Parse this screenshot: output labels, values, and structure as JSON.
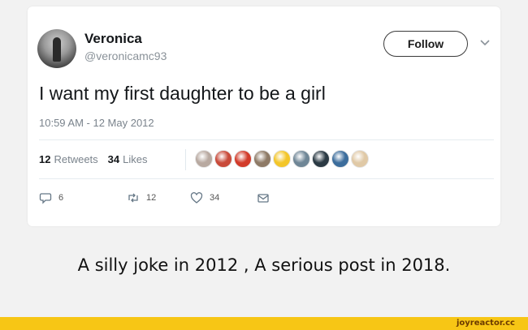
{
  "tweet": {
    "author_name": "Veronica",
    "handle": "@veronicamc93",
    "follow_label": "Follow",
    "text": "I want my first daughter to be a girl",
    "timestamp": "10:59 AM - 12 May 2012",
    "retweets_count": "12",
    "retweets_label": "Retweets",
    "likes_count": "34",
    "likes_label": "Likes",
    "reply_count": "6",
    "retweet_action_count": "12",
    "like_action_count": "34",
    "icons": {
      "reply": "reply-icon",
      "retweet": "retweet-icon",
      "like": "heart-icon",
      "dm": "direct-message-icon",
      "menu": "chevron-down-icon"
    },
    "liker_colors": [
      "#b8a9a0",
      "#c94a3a",
      "#d23b2a",
      "#8e7a66",
      "#f3c62a",
      "#6f8696",
      "#2b3a44",
      "#3c6d9c",
      "#e0c9a6"
    ]
  },
  "caption": "A silly joke in 2012 , A serious post in 2018.",
  "footer": {
    "site": "joyreactor.cc",
    "accent_color": "#f7c615"
  }
}
